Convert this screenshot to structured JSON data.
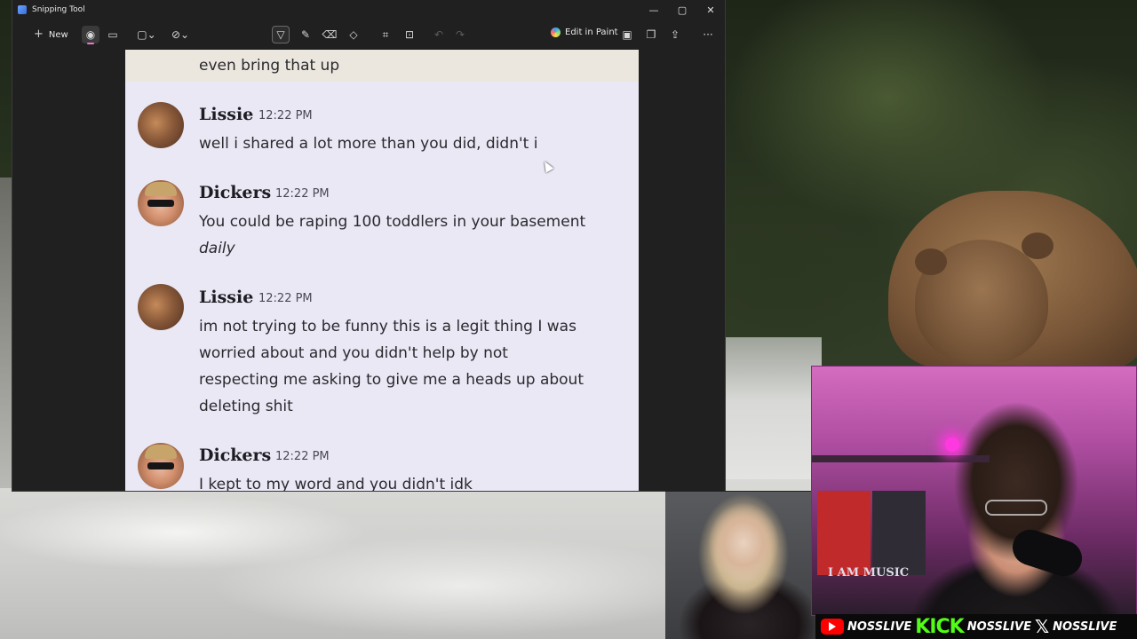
{
  "window": {
    "title": "Snipping Tool",
    "controls": {
      "minimize": "—",
      "maximize": "▢",
      "close": "✕"
    }
  },
  "toolbar": {
    "new_label": "New",
    "plus": "+",
    "edit_in_paint_label": "Edit in Paint",
    "more": "···"
  },
  "chat": {
    "top_text": "even bring that up",
    "messages": [
      {
        "author": "Lissie",
        "time": "12:22 PM",
        "lines": [
          "well i shared a lot more than you did, didn't i"
        ]
      },
      {
        "author": "Dickers",
        "time": "12:22 PM",
        "lines": [
          "You could be raping 100 toddlers in your basement"
        ],
        "italic_line": "daily"
      },
      {
        "author": "Lissie",
        "time": "12:22 PM",
        "lines": [
          "im not trying to be funny this is a legit thing I was",
          "worried about and you didn't help by not",
          "respecting me asking to give me a heads up about",
          "deleting shit"
        ]
      },
      {
        "author": "Dickers",
        "time": "12:22 PM",
        "lines": [
          "I kept to my word and you didn't idk"
        ]
      }
    ]
  },
  "overlay": {
    "sign_text": "I AM MUSIC",
    "social": {
      "handle_youtube": "NOSSLIVE",
      "kick_logo": "KICK",
      "handle_kick": "NOSSLIVE",
      "x_logo": "𝕏",
      "handle_x": "NOSSLIVE"
    }
  },
  "colors": {
    "accent": "#e879c9",
    "chat_bg": "#e9e8f4",
    "kick_green": "#53fc18",
    "youtube_red": "#ff0000"
  }
}
